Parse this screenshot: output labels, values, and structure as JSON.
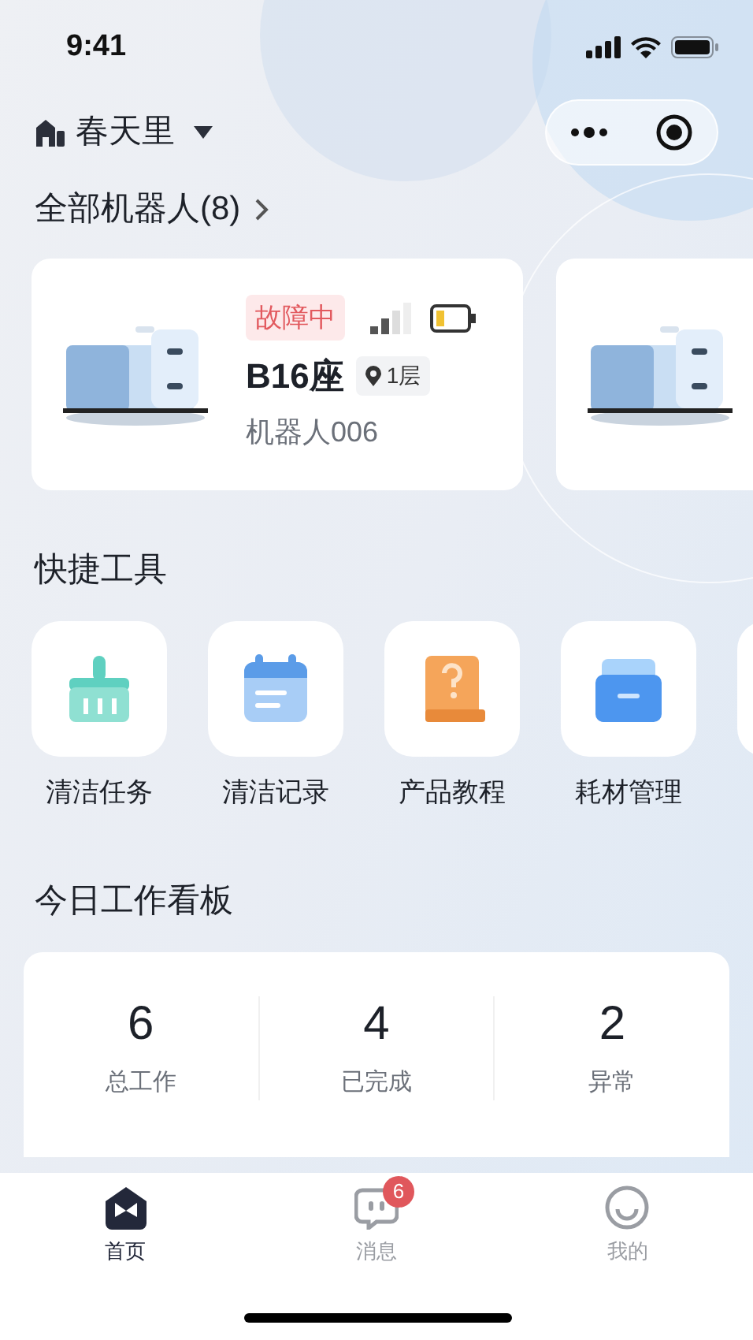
{
  "status_bar": {
    "time": "9:41"
  },
  "header": {
    "location": "春天里"
  },
  "robots_section": {
    "title": "全部机器人(8)",
    "robots": [
      {
        "kind": "full",
        "status": "故障中",
        "name": "B16座",
        "floor": "1层",
        "id": "机器人006"
      },
      {
        "kind": "picture"
      }
    ]
  },
  "tools_section": {
    "title": "快捷工具",
    "tools": [
      {
        "kind": "brush",
        "label": "清洁任务"
      },
      {
        "kind": "calendar",
        "label": "清洁记录"
      },
      {
        "kind": "book",
        "label": "产品教程"
      },
      {
        "kind": "box",
        "label": "耗材管理"
      },
      {
        "kind": "blank"
      }
    ]
  },
  "board": {
    "title": "今日工作看板",
    "stats": [
      {
        "value": "6",
        "label": "总工作"
      },
      {
        "value": "4",
        "label": "已完成"
      },
      {
        "value": "2",
        "label": "异常"
      }
    ]
  },
  "tab_bar": [
    {
      "kind": "home",
      "label": "首页",
      "selected": true
    },
    {
      "kind": "message",
      "label": "消息",
      "selected": false,
      "badge": "6"
    },
    {
      "kind": "smile",
      "label": "我的",
      "selected": false
    }
  ]
}
